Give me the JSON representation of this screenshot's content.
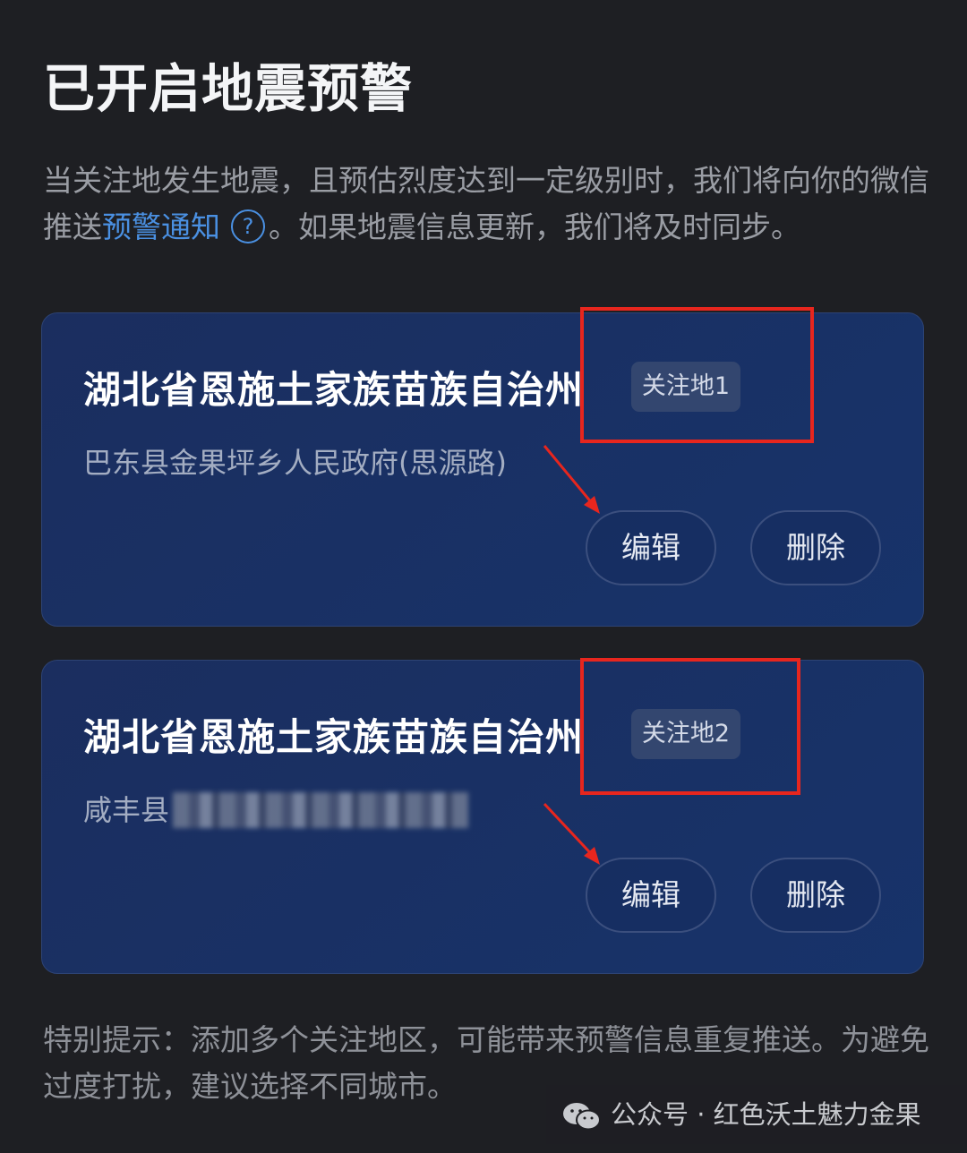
{
  "title": "已开启地震预警",
  "intro": {
    "text_before": "当关注地发生地震，且预估烈度达到一定级别时，我们将向你的微信推送",
    "link": "预警通知",
    "text_after": "。如果地震信息更新，我们将及时同步。"
  },
  "help_icon": "question-circle-icon",
  "cards": [
    {
      "title": "湖北省恩施土家族苗族自治州",
      "tag": "关注地1",
      "subtitle": "巴东县金果坪乡人民政府(思源路)",
      "edit_label": "编辑",
      "delete_label": "删除"
    },
    {
      "title": "湖北省恩施土家族苗族自治州",
      "tag": "关注地2",
      "subtitle_prefix": "咸丰县",
      "edit_label": "编辑",
      "delete_label": "删除"
    }
  ],
  "tip": "特别提示：添加多个关注地区，可能带来预警信息重复推送。为避免过度打扰，建议选择不同城市。",
  "watermark": {
    "text": "公众号 · 红色沃土魅力金果",
    "icon": "wechat-icon"
  },
  "colors": {
    "background": "#1e1f23",
    "card": "#1b2e5f",
    "link": "#4a90e2",
    "annotation": "#e7261e"
  }
}
